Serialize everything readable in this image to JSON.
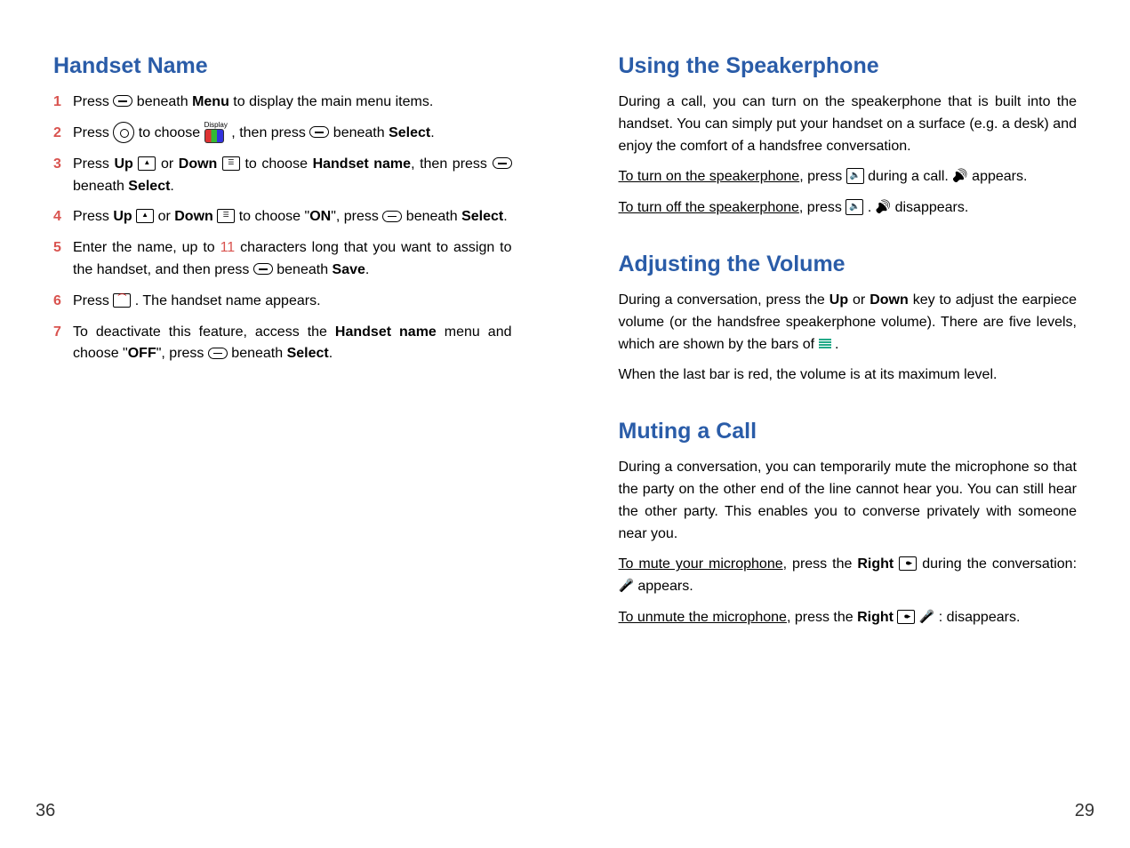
{
  "left": {
    "page_num": "36",
    "heading": "Handset Name",
    "steps": {
      "s1": {
        "n": "1",
        "a": "Press ",
        "b": " beneath ",
        "menu": "Menu",
        "c": " to display the main menu items."
      },
      "s2": {
        "n": "2",
        "a": "Press ",
        "b": " to choose ",
        "c": " , then press ",
        "d": " beneath ",
        "select": "Select",
        "dot": "."
      },
      "s3": {
        "n": "3",
        "a": "Press ",
        "up": "Up",
        "b": " or ",
        "down": "Down",
        "c": " to choose ",
        "hn": "Handset name",
        "d": ", then press ",
        "e": " beneath ",
        "select": "Select",
        "dot": "."
      },
      "s4": {
        "n": "4",
        "a": "Press ",
        "up": "Up",
        "b": " or ",
        "down": "Down",
        "c": " to choose \"",
        "on": "ON",
        "d": "\", press ",
        "e": " beneath ",
        "select": "Select",
        "dot": "."
      },
      "s5": {
        "n": "5",
        "a": "Enter the name, up to ",
        "eleven": "11",
        "b": " characters long that you want to assign to the handset, and then press ",
        "c": " beneath ",
        "save": "Save",
        "dot": "."
      },
      "s6": {
        "n": "6",
        "a": "Press ",
        "b": " . The handset name appears."
      },
      "s7": {
        "n": "7",
        "a": "To deactivate this feature, access the ",
        "hn": "Handset name",
        "b": " menu and choose \"",
        "off": "OFF",
        "c": "\", press ",
        "d": " beneath ",
        "select": "Select",
        "dot": "."
      }
    }
  },
  "right": {
    "page_num": "29",
    "spk": {
      "heading": "Using the Speakerphone",
      "p1": "During a call, you can turn on the speakerphone that is built into the handset. You can simply put your handset on a surface (e.g. a desk) and enjoy the comfort of a handsfree conversation.",
      "on_a": "To turn on the speakerphone",
      "on_b": ", press ",
      "on_c": " during a call. ",
      "on_d": " appears.",
      "off_a": "To turn off the speakerphone",
      "off_b": ", press ",
      "off_c": " . ",
      "off_d": " disappears."
    },
    "vol": {
      "heading": "Adjusting the Volume",
      "p1a": "During a conversation, press the ",
      "up": "Up",
      "p1b": " or ",
      "down": "Down",
      "p1c": " key to adjust the earpiece volume (or the handsfree speakerphone volume). There are five levels, which are shown by the bars of  ",
      "p1d": " .",
      "p2": "When the last bar is red, the volume is at its maximum level."
    },
    "mute": {
      "heading": "Muting a Call",
      "p1": "During a conversation, you can temporarily mute the microphone so that the party on the other end of the line cannot hear you. You can still hear the other party. This enables you to converse privately with someone near you.",
      "m_a": "To mute your microphone",
      "m_b": ", press the ",
      "right": "Right",
      "m_c": "  during the conversation:  ",
      "m_d": "  appears.",
      "u_a": "To unmute the microphone",
      "u_b": ", press the ",
      "right2": "Right",
      "u_c": " : ",
      "u_d": " disappears."
    }
  },
  "icons": {
    "display_label": "Display"
  }
}
